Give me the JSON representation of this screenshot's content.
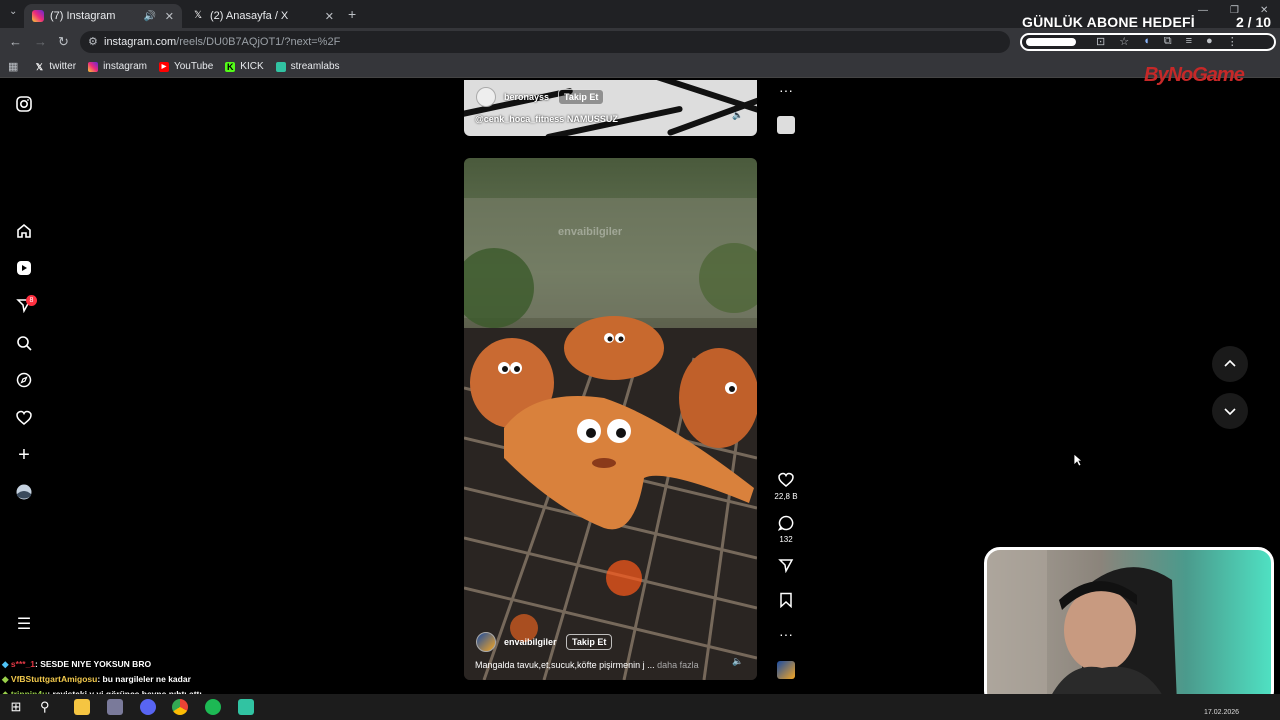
{
  "browser": {
    "tabs": [
      {
        "title": "(7) Instagram",
        "active": true
      },
      {
        "title": "(2) Anasayfa / X",
        "active": false
      }
    ],
    "url_main": "instagram.com",
    "url_rest": "/reels/DU0B7AQjOT1/?next=%2F",
    "bookmarks": [
      {
        "label": "twitter",
        "icon": "x-icon"
      },
      {
        "label": "instagram",
        "icon": "instagram-icon"
      },
      {
        "label": "YouTube",
        "icon": "youtube-icon"
      },
      {
        "label": "KICK",
        "icon": "kick-icon"
      },
      {
        "label": "streamlabs",
        "icon": "streamlabs-icon"
      }
    ]
  },
  "overlay": {
    "goal_title": "GÜNLÜK ABONE HEDEFİ",
    "goal_current": "2",
    "goal_sep": " / ",
    "goal_total": "10",
    "goal_progress": 0.2,
    "logo": "ByNoGame"
  },
  "reel_top": {
    "username": "beronayss",
    "follow": "Takip Et",
    "caption": "@cenk_hoca_fitness NAMUSSUZ"
  },
  "reel_main": {
    "watermark": "envaibilgiler",
    "username": "envaibilgiler",
    "follow": "Takip Et",
    "caption": "Mangalda tavuk,et,sucuk,köfte pişirmenin j ...",
    "more": "daha fazla",
    "likes": "22,8 B",
    "comments": "132"
  },
  "chat": [
    {
      "user": "s***_1",
      "text": ": SESDE NIYE YOKSUN BRO"
    },
    {
      "user": "VfBStuttgartAmigosu",
      "text": ": bu nargileler ne kadar"
    },
    {
      "user": "trippin4u",
      "text": ": reyisteki y yi görünce beyne pıhtı attı"
    }
  ],
  "notifications_badge": "8",
  "taskbar": {
    "date": "17.02.2026"
  },
  "colors": {
    "accent_red": "#c62828",
    "ig_badge": "#ff3040"
  }
}
